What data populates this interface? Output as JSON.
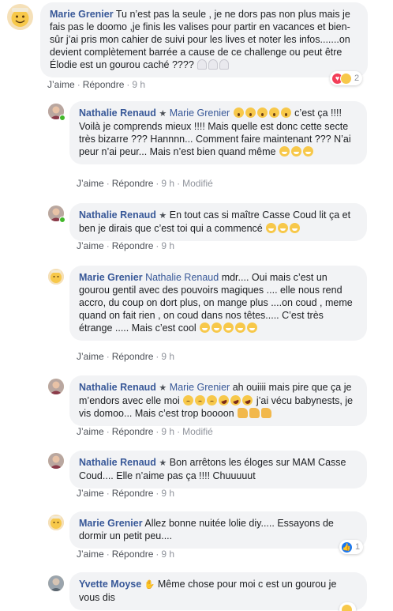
{
  "colors": {
    "author": "#385898",
    "bubble": "#f2f3f5",
    "meta": "#90949c",
    "like": "#1877f2",
    "love": "#f33e58"
  },
  "labels": {
    "like": "J’aime",
    "reply": "Répondre",
    "edited": "Modifié",
    "dot": "·"
  },
  "comments": [
    {
      "author": "Marie Grenier",
      "text": "Tu n’est pas la seule , je ne dors pas non plus mais je fais pas le doomo ,je finis les valises pour partir en vacances et bien-sûr j’ai pris mon cahier de suivi pour les lives et noter les infos.......on devient complètement barrée a cause de ce challenge ou peut être Élodie est un gourou caché ????",
      "time": "9 h",
      "reaction_count": "2"
    },
    {
      "author": "Nathalie Renaud",
      "mention": "Marie Grenier",
      "text": "c’est ça !!!! Voilà je comprends mieux !!!! Mais quelle est donc cette secte très bizarre ??? Hannnn... Comment faire maintenant ??? N’ai peur n’ai peur... Mais n’est bien quand même",
      "time": "9 h",
      "edited": true
    },
    {
      "author": "Nathalie Renaud",
      "text": "En tout cas si maître Casse Coud lit ça et ben je dirais que c’est toi qui a commencé",
      "time": "9 h"
    },
    {
      "author": "Marie Grenier",
      "mention": "Nathalie Renaud",
      "text": "mdr.... Oui mais c’est un gourou gentil avec des pouvoirs magiques .... elle nous rend accro, du coup on dort plus, on mange plus ....on coud , meme quand on fait rien , on coud dans nos têtes..... C’est très étrange ..... Mais c’est cool",
      "time": "9 h"
    },
    {
      "author": "Nathalie Renaud",
      "mention": "Marie Grenier",
      "text_a": "ah ouiiii mais pire que ça je m’endors avec elle moi",
      "text_b": "j’ai vécu babynests, je vis domoo... Mais c’est trop boooon",
      "time": "9 h",
      "edited": true
    },
    {
      "author": "Nathalie Renaud",
      "text": "Bon arrêtons les éloges sur MAM Casse Coud.... Elle n’aime pas ça !!!! Chuuuuut",
      "time": "9 h"
    },
    {
      "author": "Marie Grenier",
      "text": "Allez bonne nuitée lolie diy..... Essayons de dormir un petit peu....",
      "time": "9 h",
      "reaction_count": "1"
    },
    {
      "author": "Yvette Moyse",
      "text": "Même chose pour moi c est un gourou je vous dis"
    }
  ]
}
